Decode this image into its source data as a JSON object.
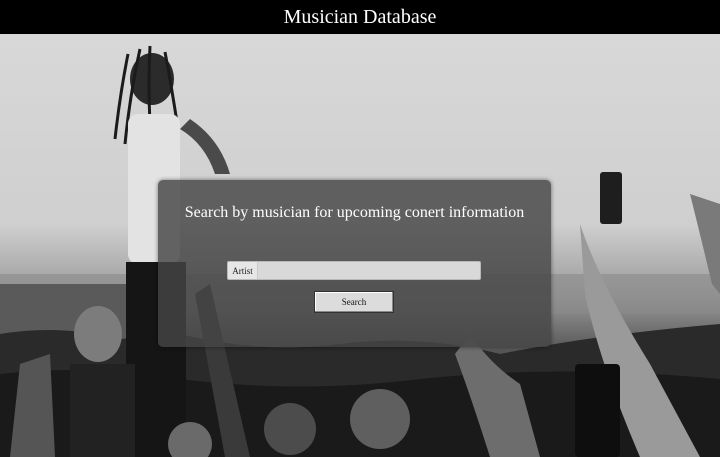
{
  "header": {
    "title": "Musician Database"
  },
  "search": {
    "heading": "Search by musician for upcoming conert information",
    "field_label": "Artist",
    "field_value": "",
    "field_placeholder": "",
    "button_label": "Search"
  }
}
